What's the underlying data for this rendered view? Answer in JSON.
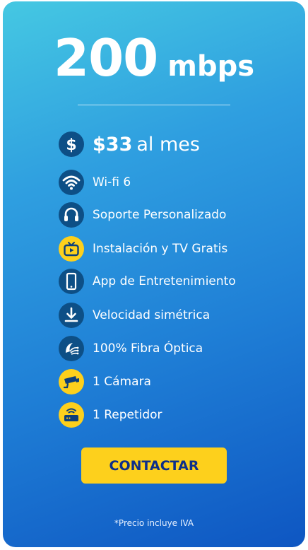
{
  "plan": {
    "speed_value": "200",
    "speed_unit": "mbps"
  },
  "price": {
    "amount": "$33",
    "period": "al mes",
    "icon": "dollar-icon"
  },
  "features": [
    {
      "label": "Wi-fi 6",
      "icon": "wifi-icon",
      "style": "blue"
    },
    {
      "label": "Soporte Personalizado",
      "icon": "headset-icon",
      "style": "blue"
    },
    {
      "label": "Instalación y TV Gratis",
      "icon": "tv-icon",
      "style": "yellow"
    },
    {
      "label": "App de Entretenimiento",
      "icon": "smartphone-icon",
      "style": "blue"
    },
    {
      "label": "Velocidad simétrica",
      "icon": "download-icon",
      "style": "blue"
    },
    {
      "label": "100% Fibra Óptica",
      "icon": "fiber-optic-icon",
      "style": "blue"
    },
    {
      "label": "1 Cámara",
      "icon": "security-camera-icon",
      "style": "yellow"
    },
    {
      "label": "1 Repetidor",
      "icon": "router-icon",
      "style": "yellow"
    }
  ],
  "cta": {
    "label": "CONTACTAR"
  },
  "footnote": "*Precio incluye IVA",
  "colors": {
    "gradient_start": "#45c8e2",
    "gradient_end": "#0e56c2",
    "icon_blue": "#0d4f86",
    "accent_yellow": "#fdd01c",
    "cta_text": "#0d2f8a"
  }
}
